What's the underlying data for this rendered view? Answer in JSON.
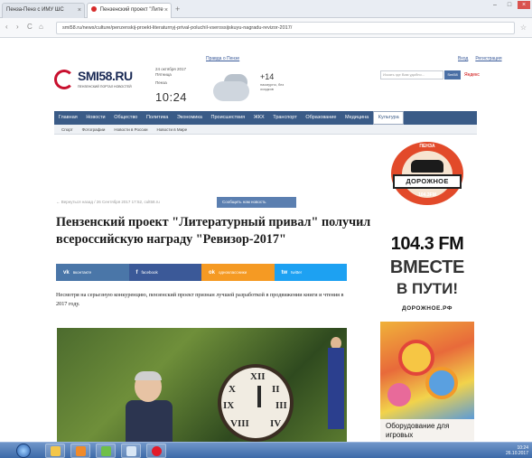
{
  "browser": {
    "tabs": [
      {
        "label": "Пенза-Пенз с ИМУ ШС"
      },
      {
        "label": "Пензенский проект \"Лите"
      }
    ],
    "url": "smi58.ru/news/culture/penzenskij-proekt-literaturnyj-prival-poluchil-vserossijskuyu-nagradu-revizor-2017/"
  },
  "site": {
    "top_link": "Правда о Пензе",
    "user_links": [
      "Вход",
      "Регистрация"
    ],
    "logo": {
      "name": "SMI58.RU",
      "tagline": "ПЕНЗЕНСКИЙ ПОРТАЛ НОВОСТЕЙ"
    },
    "date": "24 октября 2017",
    "weekday": "Пятница",
    "city": "Пенза",
    "time": "10:24",
    "weather": {
      "temp": "+14",
      "desc": "пасмурно, без осадков"
    },
    "search": {
      "placeholder": "Искать где Вам удобно...",
      "button": "Smi58",
      "engine": "Яндекс"
    }
  },
  "menu": {
    "items": [
      "Главная",
      "Новости",
      "Общество",
      "Политика",
      "Экономика",
      "Происшествия",
      "ЖКХ",
      "Транспорт",
      "Образование",
      "Медицина",
      "Культура"
    ],
    "active": "Культура",
    "sub_items": [
      "Спорт",
      "Фотографии",
      "Новости в России",
      "Новости в Мире"
    ]
  },
  "article": {
    "breadcrumb": "← Вернуться назад / 26 Сентября 2017 17:52, cult58.ru",
    "report_button": "Сообщить нам новость",
    "title": "Пензенский проект \"Литературный привал\" получил всероссийскую награду \"Ревизор-2017\"",
    "share": [
      {
        "icon": "vk",
        "label": "вконтакте",
        "color": "#4a76a8"
      },
      {
        "icon": "f",
        "label": "facebook",
        "color": "#3b5998"
      },
      {
        "icon": "ok",
        "label": "одноклассники",
        "color": "#f59a23"
      },
      {
        "icon": "tw",
        "label": "twitter",
        "color": "#1da1f2"
      }
    ],
    "lead": "Несмотря на серьезную конкуренцию, пензенский проект признан лучшей разработкой в продвижении книги и чтения в 2017 году."
  },
  "ads": {
    "radio": {
      "badge_text": "ПЕНЗА",
      "plate": "ДОРОЖНОЕ",
      "small_freq": "104.3FM",
      "freq": "104.3 FM",
      "line1": "ВМЕСТЕ",
      "line2": "В ПУТИ!",
      "site": "ДОРОЖНОЕ.РФ"
    },
    "equipment": {
      "text": "Оборудование для игровых"
    }
  },
  "taskbar": {
    "time": "10:24",
    "date": "26.10.2017"
  },
  "colors": {
    "menu": "#3a5b87",
    "brand_red": "#c8102e",
    "report": "#5b7fb0"
  }
}
